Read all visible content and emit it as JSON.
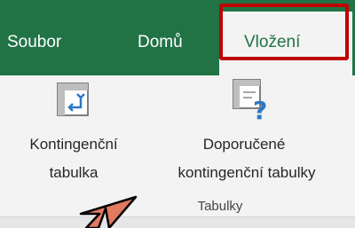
{
  "tabs": {
    "file_label": "Soubor",
    "home_label": "Domů",
    "insert_label": "Vložení"
  },
  "ribbon": {
    "group_label": "Tabulky",
    "pivot_table": {
      "line1": "Kontingenční",
      "line2": "tabulka",
      "icon": "pivot-table-icon"
    },
    "recommended_pivot": {
      "line1": "Doporučené",
      "line2": "kontingenční tabulky",
      "icon": "recommended-pivot-icon"
    }
  },
  "colors": {
    "excel_green": "#217346",
    "highlight_red": "#c00000",
    "arrow_fill": "#e07b5f",
    "icon_blue": "#2b78c5"
  }
}
